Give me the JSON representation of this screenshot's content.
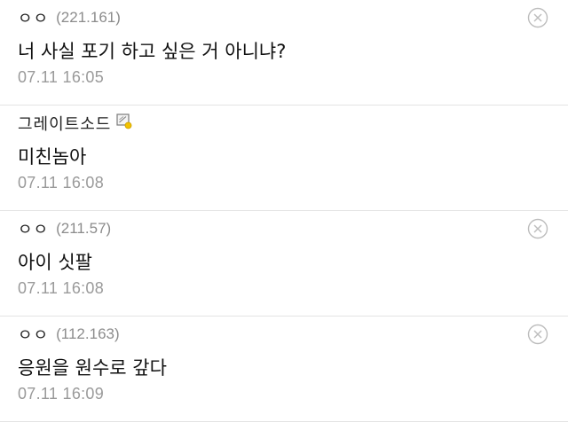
{
  "comments": [
    {
      "nick": "ㅇㅇ",
      "ip": "(221.161)",
      "text": "너 사실 포기 하고 싶은 거 아니냐?",
      "time": "07.11 16:05",
      "deletable": true
    },
    {
      "nick": "그레이트소드",
      "ip": "",
      "text": "미친놈아",
      "time": "07.11 16:08",
      "deletable": false,
      "badge_icon": "fixed-nick-badge-icon"
    },
    {
      "nick": "ㅇㅇ",
      "ip": "(211.57)",
      "text": "아이 싯팔",
      "time": "07.11 16:08",
      "deletable": true
    },
    {
      "nick": "ㅇㅇ",
      "ip": "(112.163)",
      "text": "응원을 원수로 갚다",
      "time": "07.11 16:09",
      "deletable": true
    }
  ],
  "icons": {
    "delete": "circle-x-icon",
    "badge": "fixed-nick-badge-icon"
  },
  "colors": {
    "nick": "#222222",
    "ip": "#8c8c8c",
    "time": "#9a9a9a",
    "divider": "#e4e4e4",
    "badge_accent": "#f2c200"
  }
}
